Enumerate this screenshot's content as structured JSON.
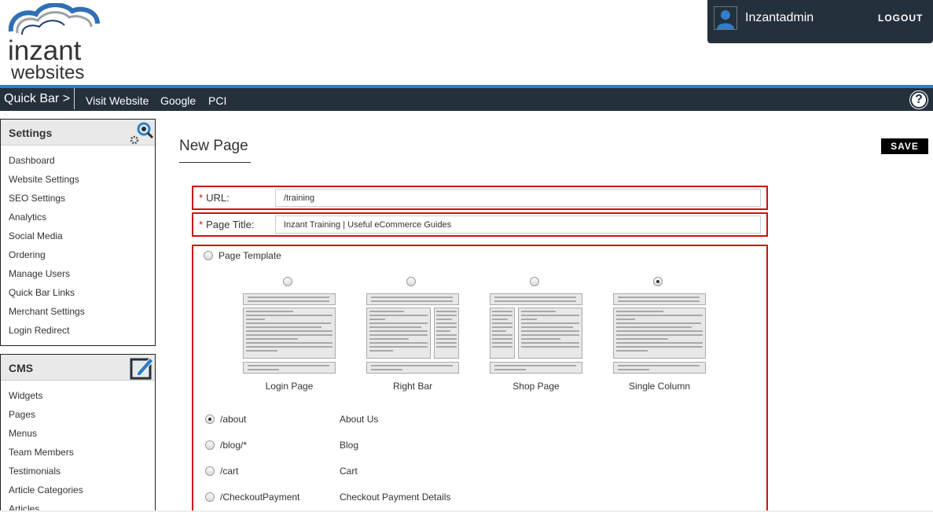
{
  "brand": {
    "logo_line1": "inzant",
    "logo_line2": "websites"
  },
  "user": {
    "name": "Inzantadmin",
    "logout_label": "LOGOUT"
  },
  "quickbar": {
    "title": "Quick Bar >",
    "links": [
      "Visit Website",
      "Google",
      "PCI"
    ],
    "help_label": "?"
  },
  "sidebar": {
    "settings": {
      "title": "Settings",
      "items": [
        "Dashboard",
        "Website Settings",
        "SEO Settings",
        "Analytics",
        "Social Media",
        "Ordering",
        "Manage Users",
        "Quick Bar Links",
        "Merchant Settings",
        "Login Redirect"
      ]
    },
    "cms": {
      "title": "CMS",
      "items": [
        "Widgets",
        "Pages",
        "Menus",
        "Team Members",
        "Testimonials",
        "Article Categories",
        "Articles"
      ]
    }
  },
  "main": {
    "page_title": "New Page",
    "save_label": "SAVE",
    "required_mark": "*",
    "url": {
      "label": "URL:",
      "value": "/training"
    },
    "page_title_field": {
      "label": "Page Title:",
      "value": "Inzant Training | Useful eCommerce Guides"
    },
    "template_option_label": "Page Template",
    "templates": [
      {
        "label": "Login Page",
        "checked": false
      },
      {
        "label": "Right Bar",
        "checked": false
      },
      {
        "label": "Shop Page",
        "checked": false
      },
      {
        "label": "Single Column",
        "checked": true
      }
    ],
    "pages": [
      {
        "path": "/about",
        "name": "About Us",
        "checked": true
      },
      {
        "path": "/blog/*",
        "name": "Blog",
        "checked": false
      },
      {
        "path": "/cart",
        "name": "Cart",
        "checked": false
      },
      {
        "path": "/CheckoutPayment",
        "name": "Checkout Payment Details",
        "checked": false
      }
    ]
  },
  "colors": {
    "header_dark": "#25303d",
    "accent_blue": "#2f7fc8",
    "required_red": "#cc1111"
  }
}
